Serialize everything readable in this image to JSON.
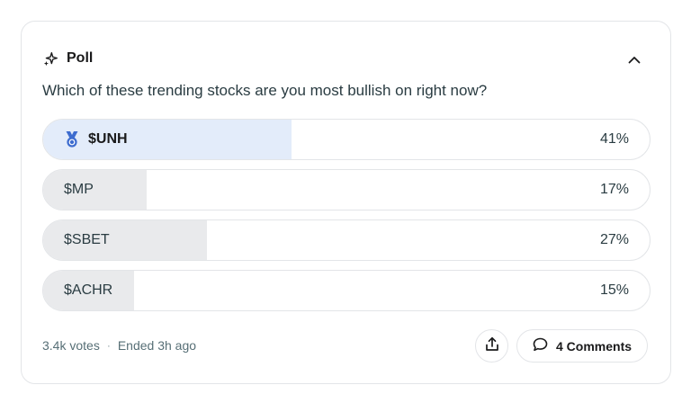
{
  "poll": {
    "title": "Poll",
    "question": "Which of these trending stocks are you most bullish on right now?",
    "options": [
      {
        "label": "$UNH",
        "percent_text": "41%",
        "percent": 41,
        "selected": true
      },
      {
        "label": "$MP",
        "percent_text": "17%",
        "percent": 17,
        "selected": false
      },
      {
        "label": "$SBET",
        "percent_text": "27%",
        "percent": 27,
        "selected": false
      },
      {
        "label": "$ACHR",
        "percent_text": "15%",
        "percent": 15,
        "selected": false
      }
    ],
    "votes": "3.4k votes",
    "separator": "·",
    "status": "Ended 3h ago"
  },
  "actions": {
    "comments_label": "4 Comments"
  },
  "icons": {
    "header": "sparkle-icon",
    "collapse": "chevron-up-icon",
    "winner": "medal-icon",
    "share": "share-icon",
    "comments": "comment-icon"
  },
  "colors": {
    "winner_fill": "#e3ecfa",
    "option_fill": "#e9eaec",
    "medal": "#3d6ccf",
    "border": "#e3e5e8",
    "meta_text": "#576f76"
  }
}
